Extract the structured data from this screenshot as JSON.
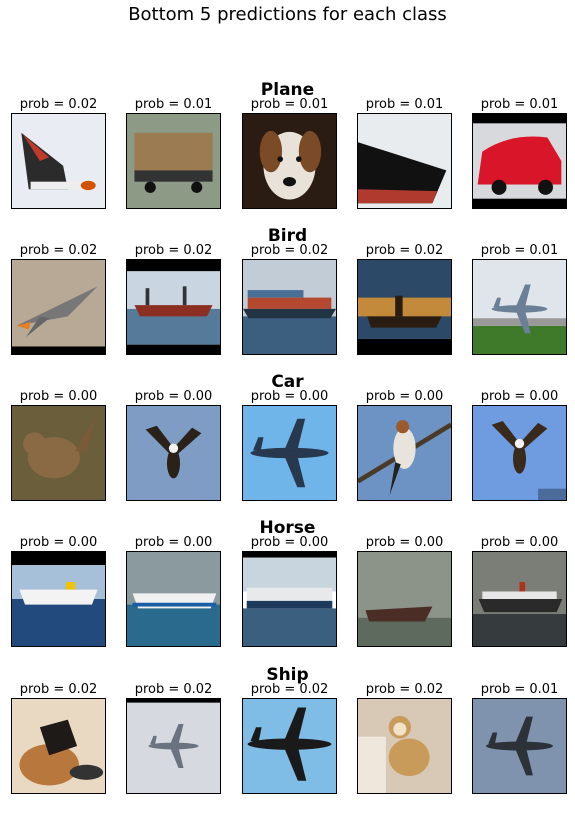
{
  "chart_data": {
    "type": "table",
    "title": "Bottom 5 predictions for each class",
    "rows": [
      {
        "class": "Plane",
        "images": [
          {
            "subject": "airplane-tail",
            "prob": "prob = 0.02"
          },
          {
            "subject": "truck",
            "prob": "prob = 0.01"
          },
          {
            "subject": "dog",
            "prob": "prob = 0.01"
          },
          {
            "subject": "ship",
            "prob": "prob = 0.01"
          },
          {
            "subject": "red-car",
            "prob": "prob = 0.01"
          }
        ]
      },
      {
        "class": "Bird",
        "images": [
          {
            "subject": "fighter-jet",
            "prob": "prob = 0.02"
          },
          {
            "subject": "cargo-ship",
            "prob": "prob = 0.02"
          },
          {
            "subject": "container-ship",
            "prob": "prob = 0.02"
          },
          {
            "subject": "warship-sunset",
            "prob": "prob = 0.02"
          },
          {
            "subject": "airliner-runway",
            "prob": "prob = 0.01"
          }
        ]
      },
      {
        "class": "Car",
        "images": [
          {
            "subject": "wren",
            "prob": "prob = 0.00"
          },
          {
            "subject": "eagle-flying",
            "prob": "prob = 0.00"
          },
          {
            "subject": "bomber-plane",
            "prob": "prob = 0.00"
          },
          {
            "subject": "bird-on-branch",
            "prob": "prob = 0.00"
          },
          {
            "subject": "eagle-landing",
            "prob": "prob = 0.00"
          }
        ]
      },
      {
        "class": "Horse",
        "images": [
          {
            "subject": "cruise-ship",
            "prob": "prob = 0.00"
          },
          {
            "subject": "ferry",
            "prob": "prob = 0.00"
          },
          {
            "subject": "car-carrier",
            "prob": "prob = 0.00"
          },
          {
            "subject": "ship-fog",
            "prob": "prob = 0.00"
          },
          {
            "subject": "ocean-liner",
            "prob": "prob = 0.00"
          }
        ]
      },
      {
        "class": "Ship",
        "images": [
          {
            "subject": "dog-lying",
            "prob": "prob = 0.02"
          },
          {
            "subject": "jet-grey-sky",
            "prob": "prob = 0.02"
          },
          {
            "subject": "vintage-bomber",
            "prob": "prob = 0.02"
          },
          {
            "subject": "monkey",
            "prob": "prob = 0.02"
          },
          {
            "subject": "airliner-sky",
            "prob": "prob = 0.01"
          }
        ]
      }
    ]
  }
}
